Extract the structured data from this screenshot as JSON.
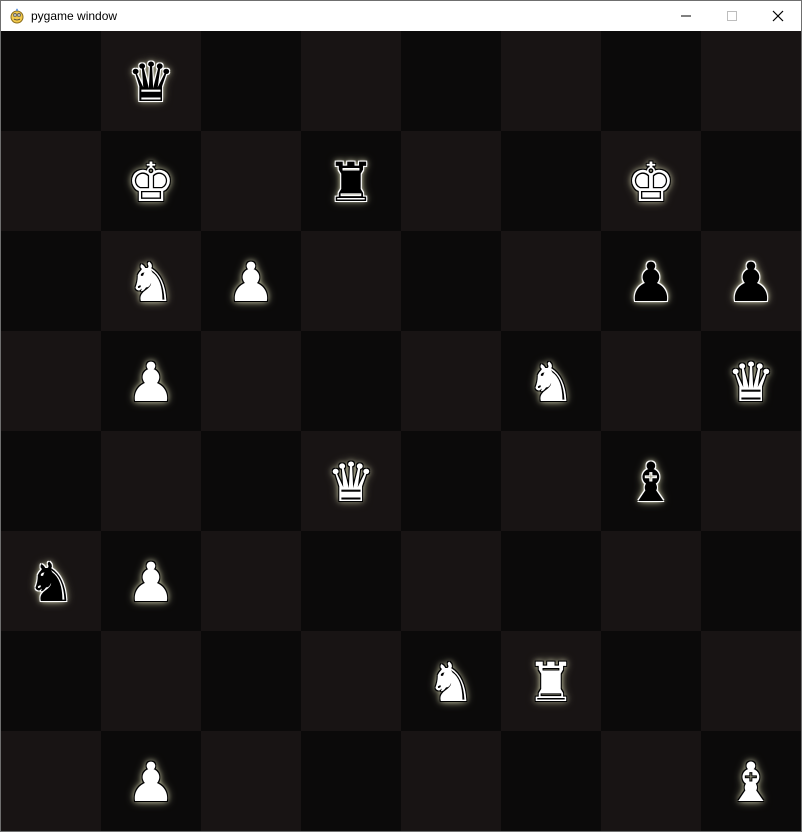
{
  "window": {
    "title": "pygame window",
    "app_icon": "pygame-snake-icon",
    "controls": {
      "minimize": "minimize-icon",
      "maximize": "maximize-icon",
      "close": "close-icon"
    }
  },
  "board": {
    "colors": {
      "dark_square": "#0b0a0a",
      "light_square": "#181414"
    },
    "pieces": [
      {
        "row": 0,
        "col": 1,
        "type": "queen",
        "color": "black",
        "glyph": "♛"
      },
      {
        "row": 1,
        "col": 1,
        "type": "king",
        "color": "white",
        "glyph": "♚"
      },
      {
        "row": 1,
        "col": 3,
        "type": "rook",
        "color": "black",
        "glyph": "♜"
      },
      {
        "row": 1,
        "col": 6,
        "type": "king",
        "color": "white",
        "glyph": "♚"
      },
      {
        "row": 2,
        "col": 1,
        "type": "knight",
        "color": "white",
        "glyph": "♞"
      },
      {
        "row": 2,
        "col": 2,
        "type": "pawn",
        "color": "white",
        "glyph": "♟"
      },
      {
        "row": 2,
        "col": 6,
        "type": "pawn",
        "color": "black",
        "glyph": "♟"
      },
      {
        "row": 2,
        "col": 7,
        "type": "pawn",
        "color": "black",
        "glyph": "♟"
      },
      {
        "row": 3,
        "col": 1,
        "type": "pawn",
        "color": "white",
        "glyph": "♟"
      },
      {
        "row": 3,
        "col": 5,
        "type": "knight",
        "color": "white",
        "glyph": "♞"
      },
      {
        "row": 3,
        "col": 7,
        "type": "queen",
        "color": "white",
        "glyph": "♛"
      },
      {
        "row": 4,
        "col": 3,
        "type": "queen",
        "color": "white",
        "glyph": "♛"
      },
      {
        "row": 4,
        "col": 6,
        "type": "bishop",
        "color": "black",
        "glyph": "♝"
      },
      {
        "row": 5,
        "col": 0,
        "type": "knight",
        "color": "black",
        "glyph": "♞"
      },
      {
        "row": 5,
        "col": 1,
        "type": "pawn",
        "color": "white",
        "glyph": "♟"
      },
      {
        "row": 6,
        "col": 4,
        "type": "knight",
        "color": "white",
        "glyph": "♞"
      },
      {
        "row": 6,
        "col": 5,
        "type": "rook",
        "color": "white",
        "glyph": "♜"
      },
      {
        "row": 7,
        "col": 1,
        "type": "pawn",
        "color": "white",
        "glyph": "♟"
      },
      {
        "row": 7,
        "col": 7,
        "type": "bishop",
        "color": "white",
        "glyph": "♝"
      }
    ]
  }
}
